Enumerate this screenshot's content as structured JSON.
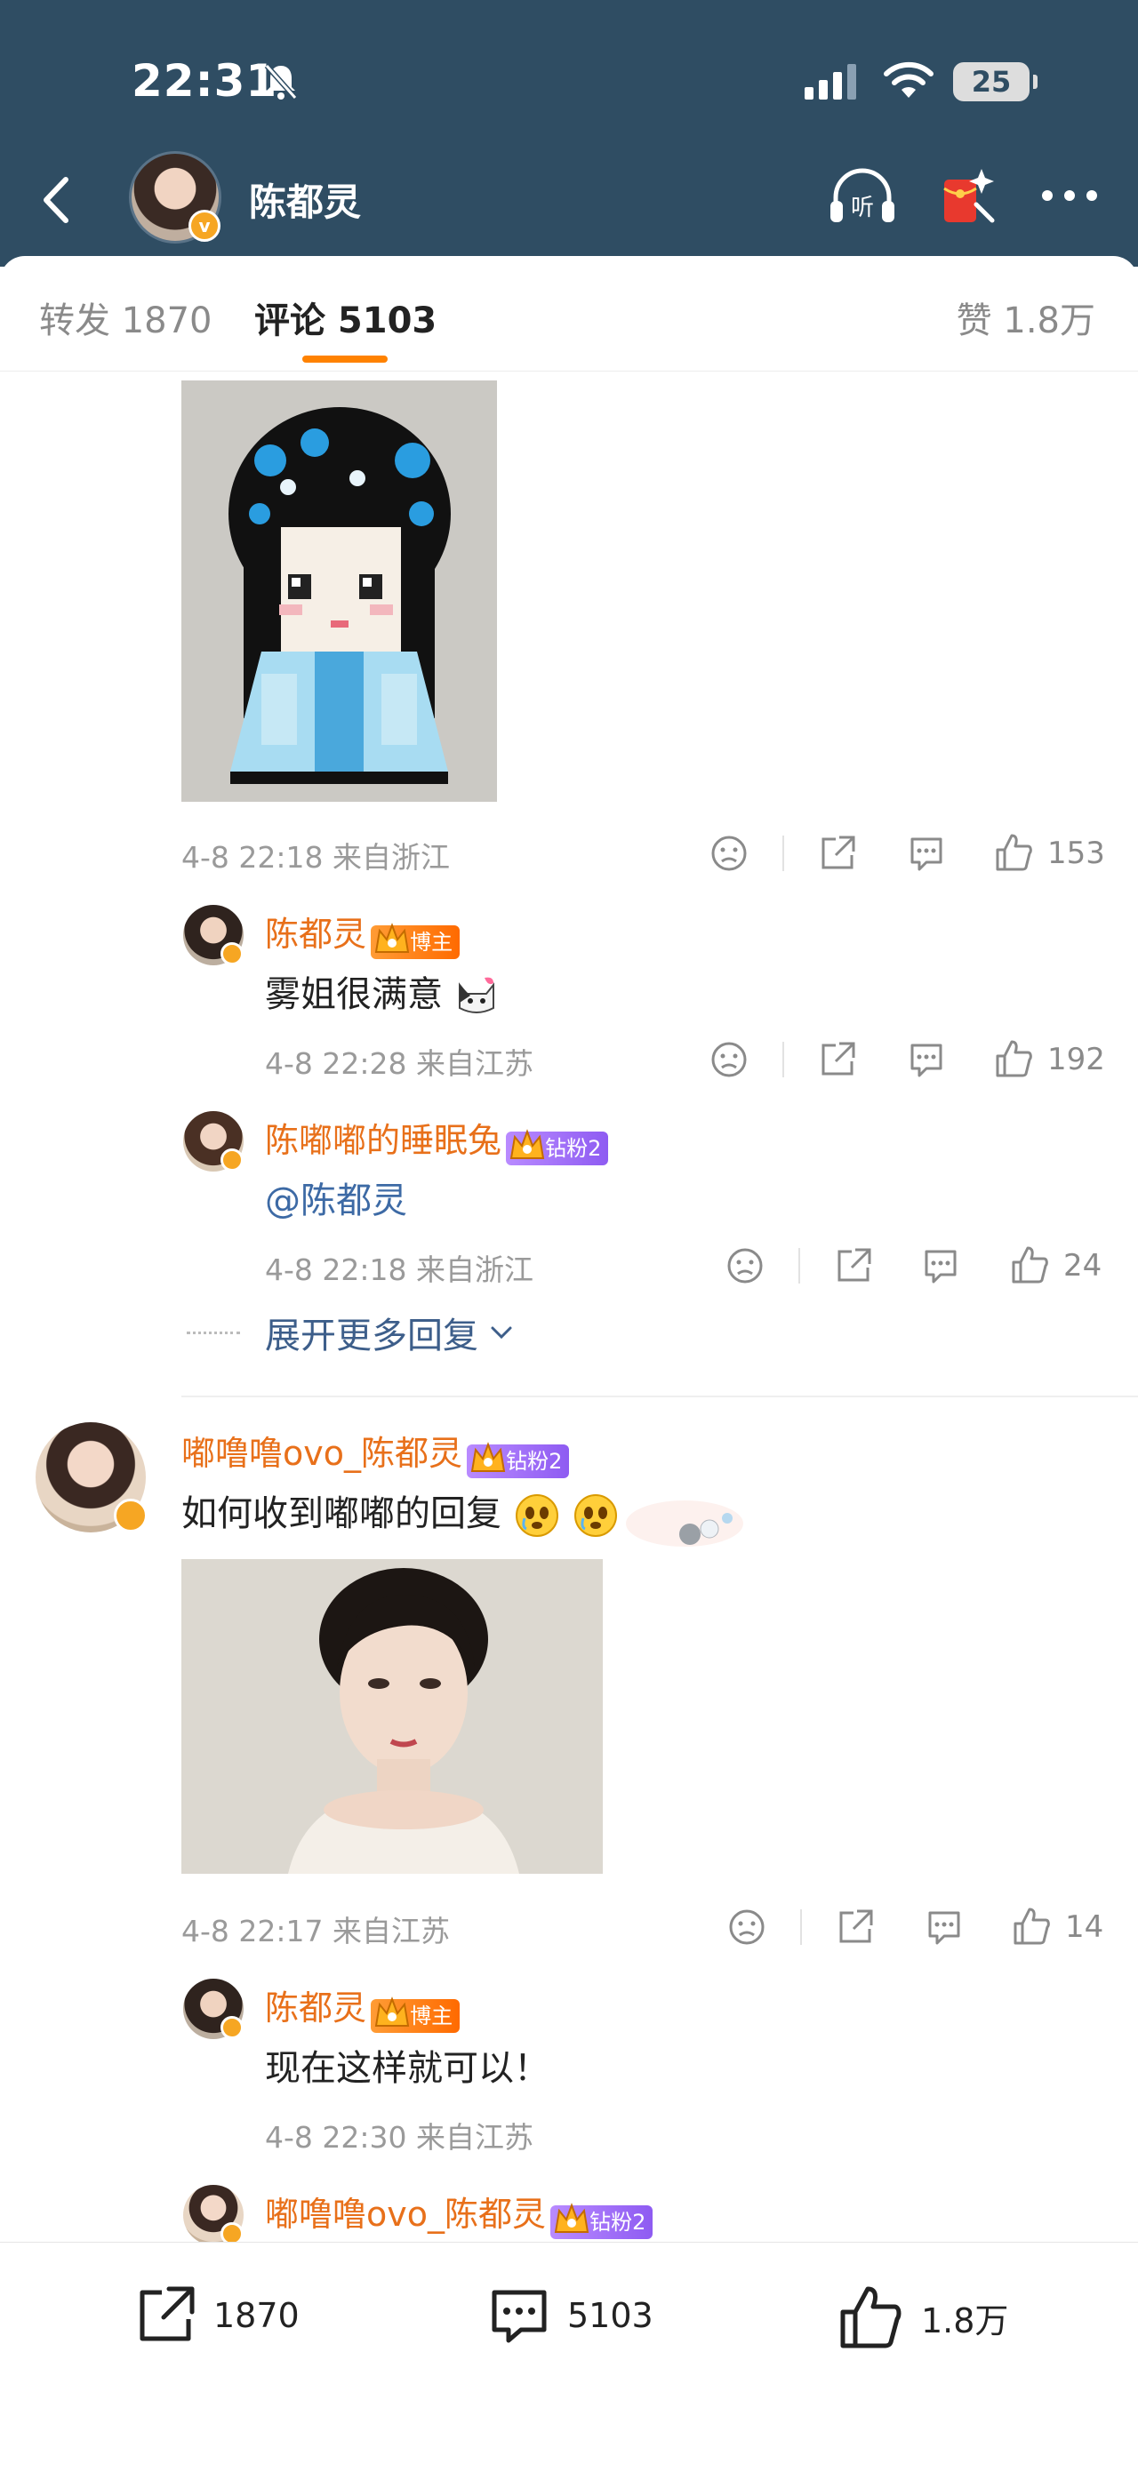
{
  "status_bar": {
    "time": "22:31",
    "battery": "25"
  },
  "header": {
    "name": "陈都灵"
  },
  "tabs": {
    "repost": "转发 1870",
    "comments": "评论 5103",
    "likes": "赞 1.8万"
  },
  "comment1": {
    "meta": "4-8 22:18 来自浙江",
    "likes": "153",
    "replies": [
      {
        "name": "陈都灵",
        "badge": "博主",
        "text": "雾姐很满意",
        "meta": "4-8 22:28 来自江苏",
        "likes": "192"
      },
      {
        "name": "陈嘟嘟的睡眠兔",
        "badge": "钻粉2",
        "text": "@陈都灵",
        "meta": "4-8 22:18 来自浙江",
        "likes": "24"
      }
    ],
    "expand_label": "展开更多回复"
  },
  "comment2": {
    "name": "嘟噜噜ovo_陈都灵",
    "badge": "钻粉2",
    "text": "如何收到嘟嘟的回复",
    "meta": "4-8 22:17 来自江苏",
    "likes": "14",
    "replies": [
      {
        "name": "陈都灵",
        "badge": "博主",
        "text": "现在这样就可以！",
        "meta": "4-8 22:30 来自江苏"
      },
      {
        "name": "嘟噜噜ovo_陈都灵",
        "badge": "钻粉2"
      }
    ]
  },
  "bottom_bar": {
    "reposts": "1870",
    "comments": "5103",
    "likes": "1.8万"
  },
  "icons": [
    "back-icon",
    "listen-icon",
    "red-packet-icon",
    "more-icon",
    "dislike-icon",
    "share-icon",
    "comment-icon",
    "like-icon",
    "chevron-down-icon"
  ],
  "colors": {
    "header_bg": "#2f4d63",
    "accent_orange": "#ff8200",
    "username": "#e8701a",
    "mention": "#3d6aa5"
  }
}
